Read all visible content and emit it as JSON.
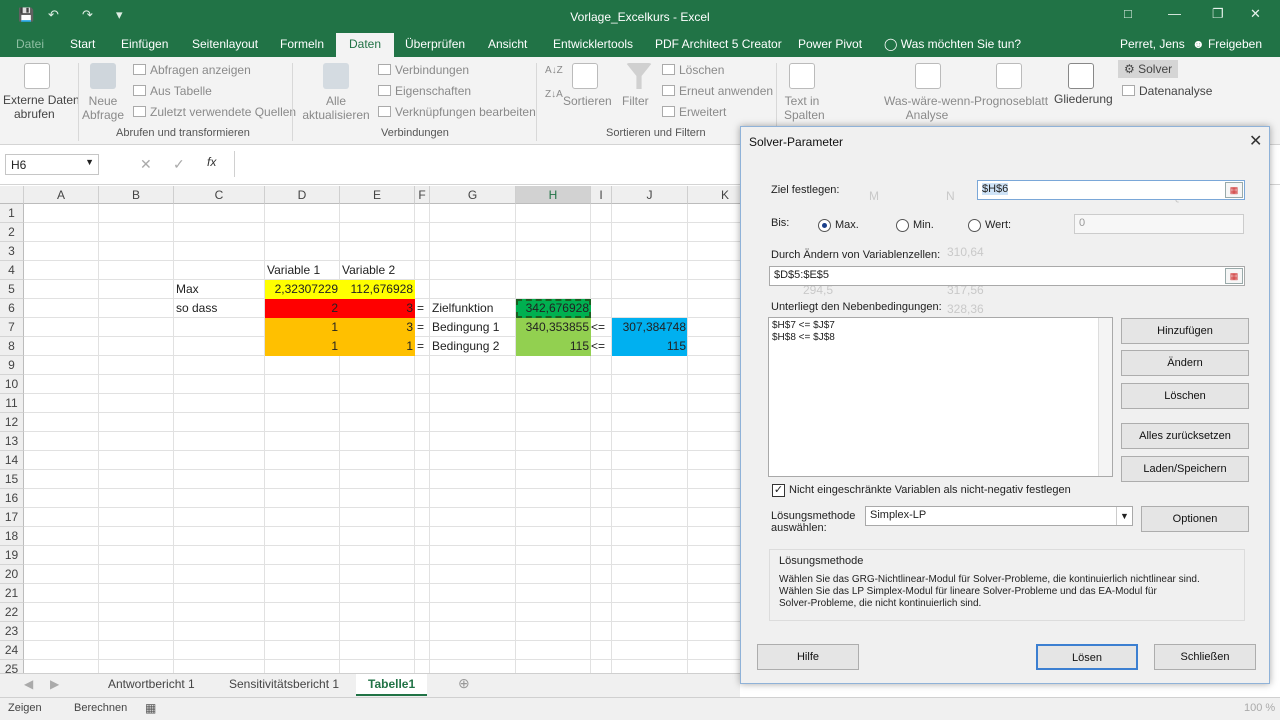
{
  "app": {
    "window_title": "Vorlage_Excelkurs - Excel"
  },
  "ribbon_tabs": [
    "Datei",
    "Start",
    "Einfügen",
    "Seitenlayout",
    "Formeln",
    "Daten",
    "Überprüfen",
    "Ansicht",
    "Entwicklertools",
    "PDF Architect 5 Creator",
    "Power Pivot"
  ],
  "tell_me": "Was möchten Sie tun?",
  "user": "Perret, Jens",
  "share": "Freigeben",
  "ribbon": {
    "externe_daten": "Externe Daten",
    "externe_daten2": "abrufen",
    "neue_abfrage": "Neue",
    "neue_abfrage2": "Abfrage",
    "abfragen_anzeigen": "Abfragen anzeigen",
    "aus_tabelle": "Aus Tabelle",
    "zuletzt_verwendet": "Zuletzt verwendete Quellen",
    "group_abrufen": "Abrufen und transformieren",
    "alle": "Alle",
    "aktualisieren": "aktualisieren",
    "verbindungen_btn": "Verbindungen",
    "eigenschaften": "Eigenschaften",
    "verknuepfungen": "Verknüpfungen bearbeiten",
    "group_verbindungen": "Verbindungen",
    "sortieren": "Sortieren",
    "filter": "Filter",
    "loeschen": "Löschen",
    "erneut_anwenden": "Erneut anwenden",
    "erweitert": "Erweitert",
    "group_sortieren": "Sortieren und Filtern",
    "text_in": "Text in",
    "spalten": "Spalten",
    "was_waere": "Was-wäre-wenn-",
    "analyse": "Analyse",
    "prognoseblatt": "Prognoseblatt",
    "gliederung": "Gliederung",
    "solver": "Solver",
    "datenanalyse": "Datenanalyse"
  },
  "formula_bar": {
    "name_box": "H6",
    "fx": "fx"
  },
  "columns": [
    "A",
    "B",
    "C",
    "D",
    "E",
    "F",
    "G",
    "H",
    "I",
    "J",
    "K"
  ],
  "rows": [
    "1",
    "2",
    "3",
    "4",
    "5",
    "6",
    "7",
    "8",
    "9",
    "10",
    "11",
    "12",
    "13",
    "14",
    "15",
    "16",
    "17",
    "18",
    "19",
    "20",
    "21",
    "22",
    "23",
    "24",
    "25"
  ],
  "cells": {
    "D4": "Variable 1",
    "E4": "Variable 2",
    "C5": "Max",
    "D5": "2,32307229",
    "E5": "112,676928",
    "C6": "so dass",
    "D6": "2",
    "E6": "3",
    "F6": "=",
    "G6": "Zielfunktion",
    "H6": "342,676928",
    "D7": "1",
    "E7": "3",
    "F7": "=",
    "G7": "Bedingung 1",
    "H7": "340,353855",
    "I7": "<=",
    "J7": "307,384748",
    "D8": "1",
    "E8": "1",
    "F8": "=",
    "G8": "Bedingung 2",
    "H8": "115",
    "I8": "<=",
    "J8": "115"
  },
  "sheet_tabs": [
    "Antwortbericht 1",
    "Sensitivitätsbericht 1",
    "Tabelle1"
  ],
  "status": {
    "mode": "Zeigen",
    "calc": "Berechnen",
    "zoom": "100 %"
  },
  "dialog": {
    "title": "Solver-Parameter",
    "ziel_label": "Ziel festlegen:",
    "ziel_value": "$H$6",
    "bis_label": "Bis:",
    "opt_max": "Max.",
    "opt_min": "Min.",
    "opt_wert": "Wert:",
    "wert_value": "0",
    "variablen_label": "Durch Ändern von Variablenzellen:",
    "variablen_value": "$D$5:$E$5",
    "neben_label": "Unterliegt den Nebenbedingungen:",
    "constraints": [
      "$H$7 <= $J$7",
      "$H$8 <= $J$8"
    ],
    "btn_hinzufuegen": "Hinzufügen",
    "btn_aendern": "Ändern",
    "btn_loeschen": "Löschen",
    "btn_alles": "Alles zurücksetzen",
    "btn_laden": "Laden/Speichern",
    "checkbox_label": "Nicht eingeschränkte Variablen als nicht-negativ festlegen",
    "methode_label": "Lösungsmethode",
    "methode_label2": "auswählen:",
    "methode_value": "Simplex-LP",
    "btn_optionen": "Optionen",
    "info_title": "Lösungsmethode",
    "info_text1": "Wählen Sie das GRG-Nichtlinear-Modul für Solver-Probleme, die kontinuierlich nichtlinear sind.",
    "info_text2": "Wählen Sie das LP Simplex-Modul für lineare Solver-Probleme und das EA-Modul für",
    "info_text3": "Solver-Probleme, die nicht kontinuierlich sind.",
    "btn_hilfe": "Hilfe",
    "btn_loesen": "Lösen",
    "btn_schliessen": "Schließen"
  },
  "colors": {
    "excel_green": "#217346",
    "yellow": "#ffff00",
    "red": "#ff0000",
    "orange": "#ffc000",
    "green": "#92d050",
    "dark_green": "#00b050",
    "blue": "#00b0f0"
  }
}
